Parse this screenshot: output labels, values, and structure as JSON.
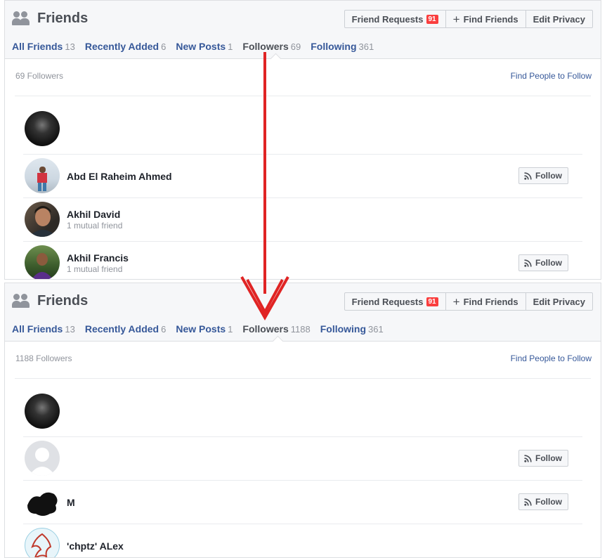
{
  "before": {
    "title": "Friends",
    "buttons": {
      "friend_requests": "Friend Requests",
      "friend_requests_badge": "91",
      "find_friends": "Find Friends",
      "edit_privacy": "Edit Privacy"
    },
    "tabs": [
      {
        "label": "All Friends",
        "count": "13"
      },
      {
        "label": "Recently Added",
        "count": "6"
      },
      {
        "label": "New Posts",
        "count": "1"
      },
      {
        "label": "Followers",
        "count": "69"
      },
      {
        "label": "Following",
        "count": "361"
      }
    ],
    "followers_count": "69 Followers",
    "find_people": "Find People to Follow",
    "rows": [
      {
        "name": "",
        "mutual": "",
        "follow": ""
      },
      {
        "name": "Abd El Raheim Ahmed",
        "mutual": "",
        "follow": "Follow"
      },
      {
        "name": "Akhil David",
        "mutual": "1 mutual friend",
        "follow": ""
      },
      {
        "name": "Akhil Francis",
        "mutual": "1 mutual friend",
        "follow": "Follow"
      }
    ]
  },
  "after": {
    "title": "Friends",
    "buttons": {
      "friend_requests": "Friend Requests",
      "friend_requests_badge": "91",
      "find_friends": "Find Friends",
      "edit_privacy": "Edit Privacy"
    },
    "tabs": [
      {
        "label": "All Friends",
        "count": "13"
      },
      {
        "label": "Recently Added",
        "count": "6"
      },
      {
        "label": "New Posts",
        "count": "1"
      },
      {
        "label": "Followers",
        "count": "1188"
      },
      {
        "label": "Following",
        "count": "361"
      }
    ],
    "followers_count": "1188 Followers",
    "find_people": "Find People to Follow",
    "rows": [
      {
        "name": "",
        "mutual": "",
        "follow": ""
      },
      {
        "name": "",
        "mutual": "",
        "follow": "Follow"
      },
      {
        "name": "M",
        "mutual": "",
        "follow": "Follow"
      },
      {
        "name": "'chptz' ALex",
        "mutual": "",
        "follow": ""
      }
    ]
  },
  "colors": {
    "link": "#365899",
    "annotation_arrow": "#e02424",
    "badge": "#fa3e3e"
  },
  "icons": {
    "friends": "friends-icon",
    "plus": "plus-icon",
    "follow": "rss-icon"
  }
}
